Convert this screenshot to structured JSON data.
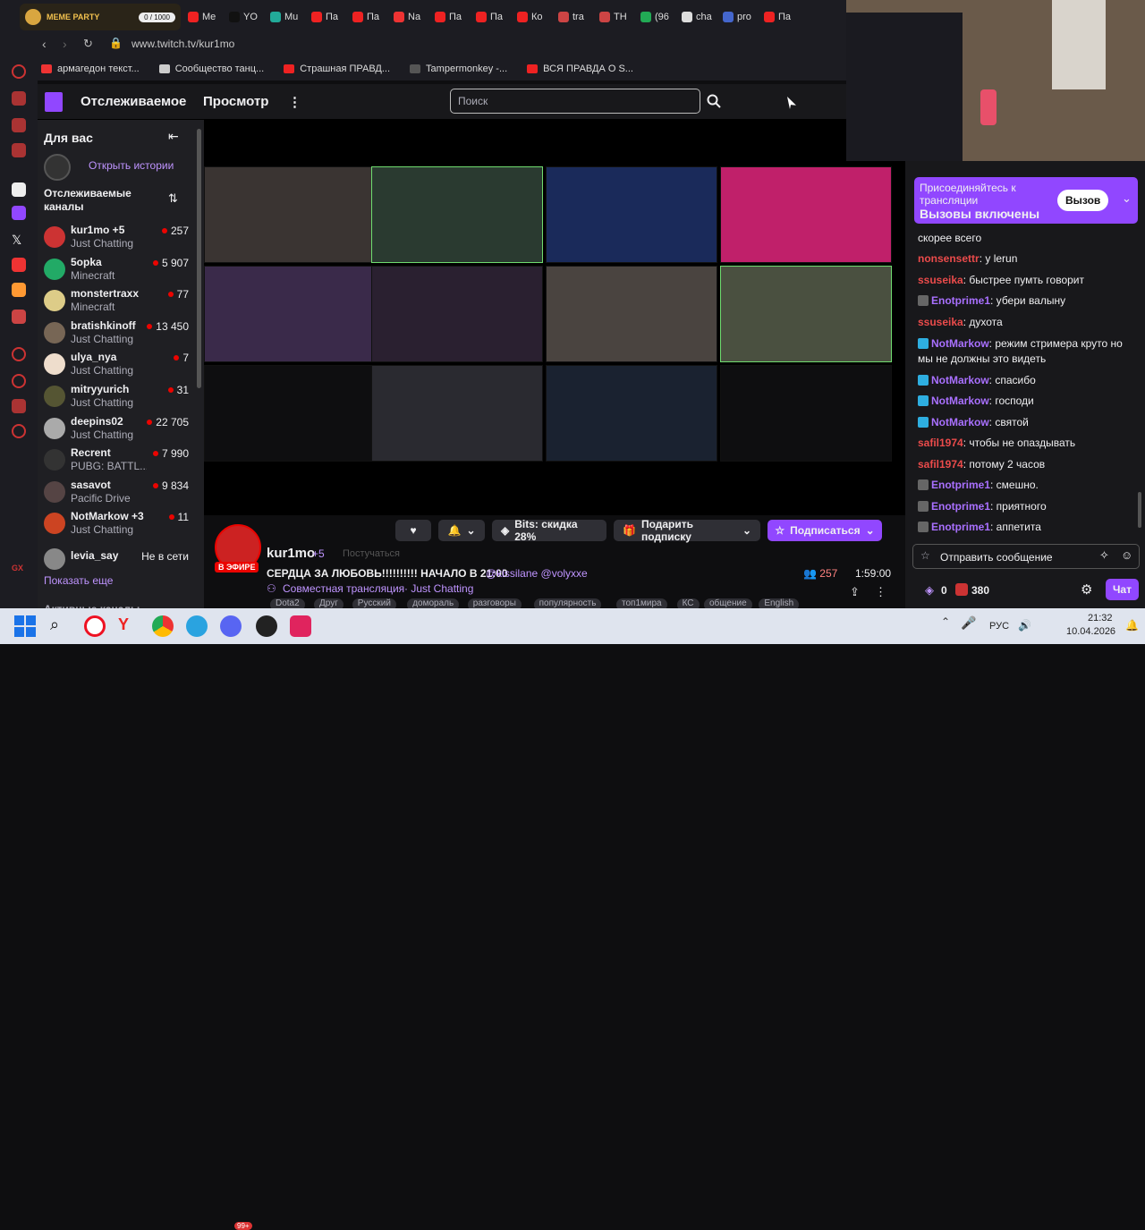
{
  "browser": {
    "meme_party": {
      "title": "MEME PARTY",
      "count": "0 / 1000"
    },
    "tabs": [
      {
        "label": "Me",
        "color": "#e22"
      },
      {
        "label": "YO",
        "color": "#111"
      },
      {
        "label": "Mu",
        "color": "#2a9"
      },
      {
        "label": "Па",
        "color": "#e22"
      },
      {
        "label": "Па",
        "color": "#e22"
      },
      {
        "label": "Na",
        "color": "#e33"
      },
      {
        "label": "Па",
        "color": "#e22"
      },
      {
        "label": "Па",
        "color": "#e22"
      },
      {
        "label": "Ко",
        "color": "#e22"
      },
      {
        "label": "tra",
        "color": "#c44"
      },
      {
        "label": "TH",
        "color": "#c44"
      },
      {
        "label": "(96",
        "color": "#2a5"
      },
      {
        "label": "cha",
        "color": "#ddd"
      },
      {
        "label": "pro",
        "color": "#46c"
      },
      {
        "label": "Па",
        "color": "#e22"
      }
    ],
    "url": "www.twitch.tv/kur1mo",
    "bookmarks": [
      {
        "label": "армагедон текст...",
        "color": "#e33"
      },
      {
        "label": "Сообщество танц...",
        "color": "#ccc"
      },
      {
        "label": "Страшная ПРАВД...",
        "color": "#e22"
      },
      {
        "label": "Tampermonkey -...",
        "color": "#555"
      },
      {
        "label": "ВСЯ ПРАВДА О S...",
        "color": "#e22"
      }
    ]
  },
  "twitch": {
    "nav_following": "Отслеживаемое",
    "nav_browse": "Просмотр",
    "search_placeholder": "Поиск"
  },
  "sidebar": {
    "for_you": "Для вас",
    "open_stories": "Открыть истории",
    "followed_heading": "Отслеживаемые каналы",
    "channels": [
      {
        "name": "kur1mo +5",
        "game": "Just Chatting",
        "viewers": "257",
        "color": "#c33"
      },
      {
        "name": "5opka",
        "game": "Minecraft",
        "viewers": "5 907",
        "color": "#2a6"
      },
      {
        "name": "monstertraxx",
        "game": "Minecraft",
        "viewers": "77",
        "color": "#dc8"
      },
      {
        "name": "bratishkinoff",
        "game": "Just Chatting",
        "viewers": "13 450",
        "color": "#765"
      },
      {
        "name": "ulya_nya",
        "game": "Just Chatting",
        "viewers": "7",
        "color": "#edc"
      },
      {
        "name": "mitryyurich",
        "game": "Just Chatting",
        "viewers": "31",
        "color": "#553"
      },
      {
        "name": "deepins02",
        "game": "Just Chatting",
        "viewers": "22 705",
        "color": "#aaa"
      },
      {
        "name": "Recrent",
        "game": "PUBG: BATTL...",
        "viewers": "7 990",
        "color": "#333"
      },
      {
        "name": "sasavot",
        "game": "Pacific Drive",
        "viewers": "9 834",
        "color": "#544"
      },
      {
        "name": "NotMarkow +3",
        "game": "Just Chatting",
        "viewers": "11",
        "color": "#c42"
      }
    ],
    "offline_channel": {
      "name": "levia_say",
      "status": "Не в сети"
    },
    "show_more": "Показать еще",
    "active_channels": "Активные каналы"
  },
  "stream": {
    "streamer": "kur1mo",
    "plus": "+5",
    "following_hint": "Постучаться",
    "live_badge": "В ЭФИРЕ",
    "title_text": "СЕРДЦА ЗА ЛЮБОВЬ!!!!!!!!!! НАЧАЛО В 21:00",
    "title_mentions": "@kissilane @volyxxe",
    "collab": "Совместная трансляция",
    "category": "Just Chatting",
    "viewers": "257",
    "uptime": "1:59:00",
    "bits_label": "Bits: скидка 28%",
    "gift_label": "Подарить подписку",
    "subscribe_label": "Подписаться",
    "tags": [
      "Dota2",
      "Друг",
      "Русский",
      "домораль",
      "разговоры",
      "популярность",
      "топ1мира",
      "КС",
      "общение",
      "English"
    ]
  },
  "chat": {
    "banner_text": "Присоединяйтесь к трансляции",
    "banner_sub": "Вызовы включены",
    "banner_button": "Вызов",
    "messages": [
      {
        "user": "",
        "text": "скорее всего",
        "color": "#efeff1",
        "badge": ""
      },
      {
        "user": "nonsensettr",
        "text": ": у lerun",
        "color": "#eb4b4b",
        "badge": ""
      },
      {
        "user": "ssuseika",
        "text": ": быстрее пумть говорит",
        "color": "#eb4b4b",
        "badge": ""
      },
      {
        "user": "Enotprime1",
        "text": ": убери валыну",
        "color": "#a970ff",
        "badge": "grey"
      },
      {
        "user": "ssuseika",
        "text": ": духота",
        "color": "#eb4b4b",
        "badge": ""
      },
      {
        "user": "NotMarkow",
        "text": ": режим стримера круто но мы не должны это видеть",
        "color": "#a970ff",
        "badge": "blue"
      },
      {
        "user": "NotMarkow",
        "text": ": спасибо",
        "color": "#a970ff",
        "badge": "blue"
      },
      {
        "user": "NotMarkow",
        "text": ": господи",
        "color": "#a970ff",
        "badge": "blue"
      },
      {
        "user": "NotMarkow",
        "text": ": святой",
        "color": "#a970ff",
        "badge": "blue"
      },
      {
        "user": "safil1974",
        "text": ": чтобы не опаздывать",
        "color": "#eb4b4b",
        "badge": ""
      },
      {
        "user": "safil1974",
        "text": ": потому 2 часов",
        "color": "#eb4b4b",
        "badge": ""
      },
      {
        "user": "Enotprime1",
        "text": ": смешно.",
        "color": "#a970ff",
        "badge": "grey"
      },
      {
        "user": "Enotprime1",
        "text": ": приятного",
        "color": "#a970ff",
        "badge": "grey"
      },
      {
        "user": "Enotprime1",
        "text": ": аппетита",
        "color": "#a970ff",
        "badge": "grey"
      }
    ],
    "input_placeholder": "Отправить сообщение",
    "bits_count": "0",
    "points": "380",
    "chat_button": "Чат"
  },
  "tiles": [
    {
      "color": "#3a3432"
    },
    {
      "color": "#2a3a30"
    },
    {
      "color": "#1a2a5a"
    },
    {
      "color": "#c0206a"
    },
    {
      "color": "#3a2a4a"
    },
    {
      "color": "#2a2030"
    },
    {
      "color": "#4a4440"
    },
    {
      "color": "#4a5040"
    },
    {
      "color": "#0e0e10"
    },
    {
      "color": "#2a2a30"
    },
    {
      "color": "#1a2230"
    },
    {
      "color": "#0e0e10"
    }
  ],
  "taskbar": {
    "lang": "РУС",
    "time": "21:32",
    "date": "10.04.2026",
    "notif_count": "99+"
  }
}
